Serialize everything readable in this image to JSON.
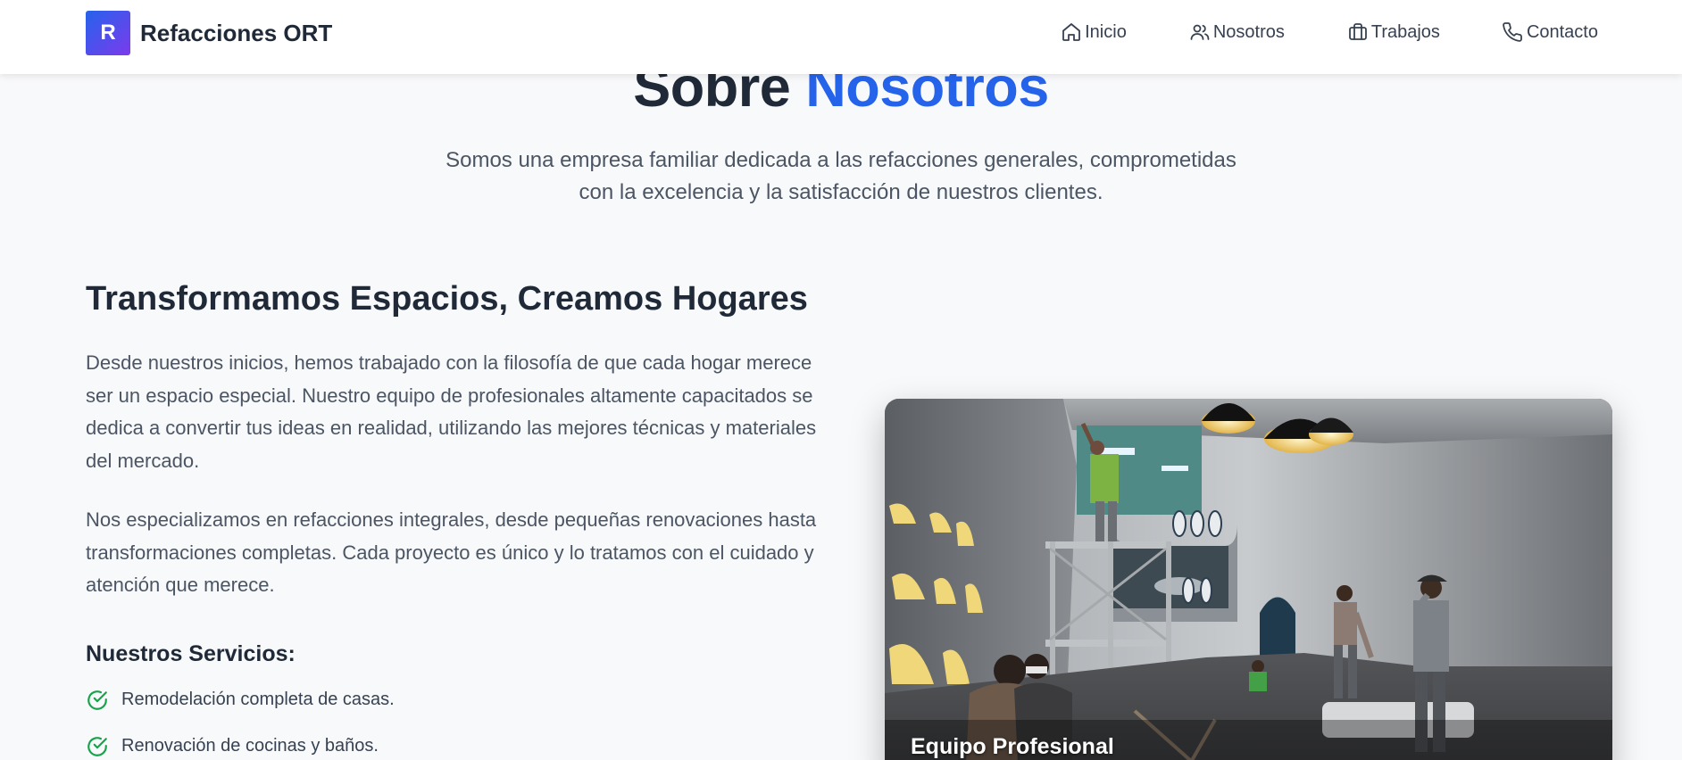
{
  "brand": {
    "logo_letter": "R",
    "name": "Refacciones ORT"
  },
  "nav": [
    {
      "label": "Inicio",
      "icon": "home-icon"
    },
    {
      "label": "Nosotros",
      "icon": "users-icon"
    },
    {
      "label": "Trabajos",
      "icon": "briefcase-icon"
    },
    {
      "label": "Contacto",
      "icon": "phone-icon"
    }
  ],
  "about": {
    "title_main": "Sobre",
    "title_accent": "Nosotros",
    "subtitle_line1": "Somos una empresa familiar dedicada a las refacciones generales, comprometidas",
    "subtitle_line2": "con la excelencia y la satisfacción de nuestros clientes.",
    "heading": "Transformamos Espacios, Creamos Hogares",
    "paragraph1": "Desde nuestros inicios, hemos trabajado con la filosofía de que cada hogar merece ser un espacio especial. Nuestro equipo de profesionales altamente capacitados se dedica a convertir tus ideas en realidad, utilizando las mejores técnicas y materiales del mercado.",
    "paragraph2": "Nos especializamos en refacciones integrales, desde pequeñas renovaciones hasta transformaciones completas. Cada proyecto es único y lo tratamos con el cuidado y atención que merece.",
    "services_heading": "Nuestros Servicios:",
    "services": [
      "Remodelación completa de casas.",
      "Renovación de cocinas y baños."
    ],
    "photo_caption": "Equipo Profesional"
  },
  "colors": {
    "accent": "#2563eb",
    "check": "#16a34a",
    "logo_gradient_from": "#2563eb",
    "logo_gradient_to": "#7c3aed"
  }
}
